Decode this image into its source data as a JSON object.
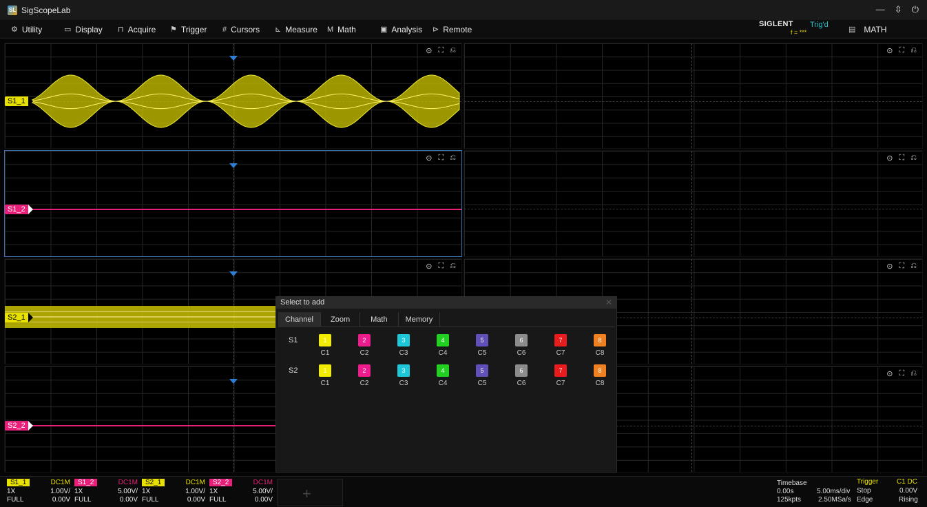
{
  "app": {
    "title": "SigScopeLab",
    "logo_text": "SL"
  },
  "window_controls": {
    "minimize": "—",
    "restore": "⇳",
    "power": "⏻"
  },
  "menu": [
    {
      "label": "Utility",
      "icon": "⚙",
      "icon_name": "utility-icon"
    },
    {
      "label": "Display",
      "icon": "▭",
      "icon_name": "display-icon"
    },
    {
      "label": "Acquire",
      "icon": "⊓",
      "icon_name": "acquire-icon"
    },
    {
      "label": "Trigger",
      "icon": "⚑",
      "icon_name": "trigger-flag-icon"
    },
    {
      "label": "Cursors",
      "icon": "#",
      "icon_name": "cursors-icon"
    },
    {
      "label": "Measure",
      "icon": "⊾",
      "icon_name": "measure-icon"
    },
    {
      "label": "Math",
      "icon": "M",
      "icon_name": "math-icon"
    },
    {
      "label": "Analysis",
      "icon": "▣",
      "icon_name": "analysis-icon"
    },
    {
      "label": "Remote",
      "icon": "⊳",
      "icon_name": "remote-icon"
    }
  ],
  "brand": {
    "name": "SIGLENT",
    "trigger_status": "Trig'd",
    "freq": "f = ***"
  },
  "math_button": {
    "label": "MATH",
    "icon": "▤"
  },
  "panel_tools": {
    "snapshot": "⊙",
    "fullscreen": "⛶",
    "restore": "⎌"
  },
  "channels": [
    {
      "label": "S1_1",
      "color": "#e8e000"
    },
    {
      "label": "S1_2",
      "color": "#e8207a"
    },
    {
      "label": "S2_1",
      "color": "#e8e000"
    },
    {
      "label": "S2_2",
      "color": "#e8207a"
    }
  ],
  "dialog": {
    "title": "Select to add",
    "close": "✕",
    "tabs": [
      "Channel",
      "Zoom",
      "Math",
      "Memory"
    ],
    "rows": [
      {
        "label": "S1",
        "chips": [
          {
            "n": "1",
            "label": "C1",
            "color": "#f4ec00"
          },
          {
            "n": "2",
            "label": "C2",
            "color": "#ec1c8c"
          },
          {
            "n": "3",
            "label": "C3",
            "color": "#1ec8d8"
          },
          {
            "n": "4",
            "label": "C4",
            "color": "#22d022"
          },
          {
            "n": "5",
            "label": "C5",
            "color": "#6050b8"
          },
          {
            "n": "6",
            "label": "C6",
            "color": "#8c8c8c"
          },
          {
            "n": "7",
            "label": "C7",
            "color": "#e81c1c"
          },
          {
            "n": "8",
            "label": "C8",
            "color": "#f08020"
          }
        ]
      },
      {
        "label": "S2",
        "chips": [
          {
            "n": "1",
            "label": "C1",
            "color": "#f4ec00"
          },
          {
            "n": "2",
            "label": "C2",
            "color": "#ec1c8c"
          },
          {
            "n": "3",
            "label": "C3",
            "color": "#1ec8d8"
          },
          {
            "n": "4",
            "label": "C4",
            "color": "#22d022"
          },
          {
            "n": "5",
            "label": "C5",
            "color": "#6050b8"
          },
          {
            "n": "6",
            "label": "C6",
            "color": "#8c8c8c"
          },
          {
            "n": "7",
            "label": "C7",
            "color": "#e81c1c"
          },
          {
            "n": "8",
            "label": "C8",
            "color": "#f08020"
          }
        ]
      }
    ]
  },
  "status": {
    "channels": [
      {
        "tag": "S1_1",
        "color": "#e8e000",
        "coupling": "DC1M",
        "probe": "1X",
        "scale": "1.00V/",
        "bw": "FULL",
        "offset": "0.00V"
      },
      {
        "tag": "S1_2",
        "color": "#e8207a",
        "coupling": "DC1M",
        "probe": "1X",
        "scale": "5.00V/",
        "bw": "FULL",
        "offset": "0.00V"
      },
      {
        "tag": "S2_1",
        "color": "#e8e000",
        "coupling": "DC1M",
        "probe": "1X",
        "scale": "1.00V/",
        "bw": "FULL",
        "offset": "0.00V"
      },
      {
        "tag": "S2_2",
        "color": "#e8207a",
        "coupling": "DC1M",
        "probe": "1X",
        "scale": "5.00V/",
        "bw": "FULL",
        "offset": "0.00V"
      }
    ],
    "add_channel": "+",
    "timebase": {
      "title": "Timebase",
      "delay": "0.00s",
      "scale": "5.00ms/div",
      "points": "125kpts",
      "rate": "2.50MSa/s"
    },
    "trigger": {
      "title": "Trigger",
      "source": "C1 DC",
      "mode": "Stop",
      "level": "0.00V",
      "type": "Edge",
      "slope": "Rising"
    }
  }
}
